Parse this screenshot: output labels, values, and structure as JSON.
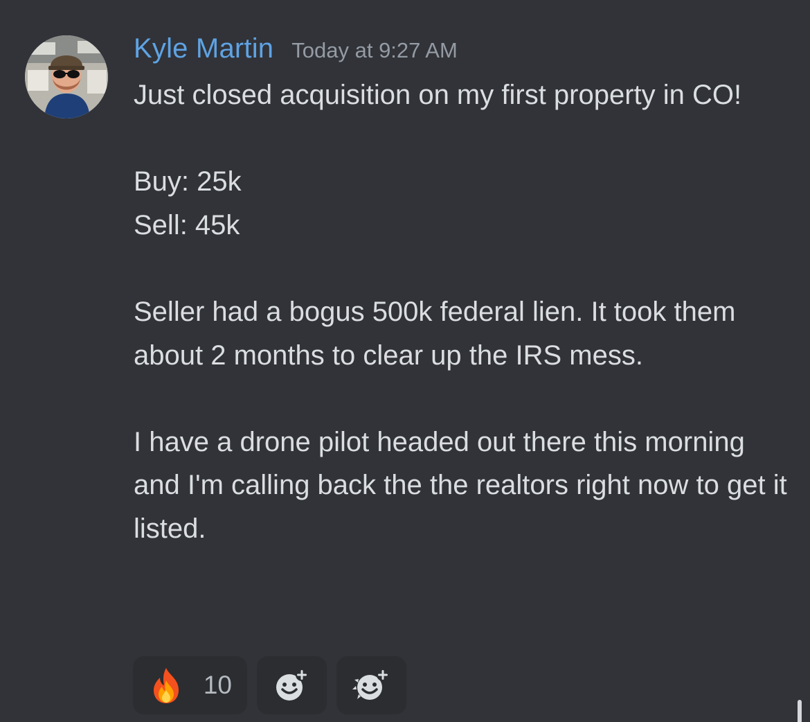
{
  "message": {
    "author": "Kyle Martin",
    "timestamp": "Today at 9:27 AM",
    "author_color": "#5fa3e4",
    "avatar_icon": "user-avatar-photo",
    "paragraphs": [
      "Just closed acquisition on my first property in CO!",
      "Buy: 25k\nSell: 45k",
      "Seller had a bogus 500k federal lien. It took them about 2 months to clear up the IRS mess.",
      "I have a drone pilot headed out there this morning and I'm calling back the the realtors right now to get it listed."
    ]
  },
  "reactions": [
    {
      "emoji": "fire-emoji",
      "count": "10"
    },
    {
      "icon": "add-reaction-icon"
    },
    {
      "icon": "add-super-reaction-icon"
    }
  ],
  "colors": {
    "background": "#313338",
    "text": "#dbdee1",
    "muted": "#949ba4",
    "reaction_bg": "#2b2d31"
  }
}
